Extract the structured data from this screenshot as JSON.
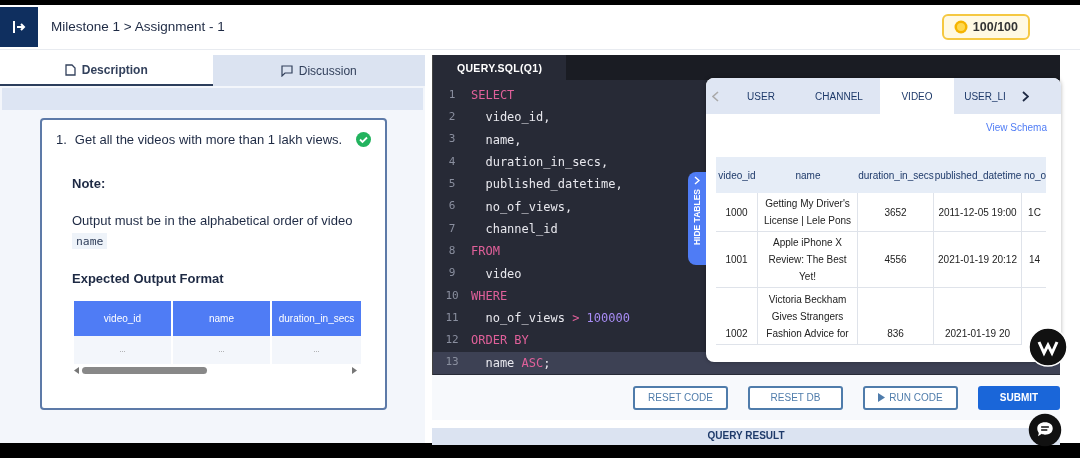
{
  "header": {
    "breadcrumb": "Milestone 1 > Assignment - 1",
    "score": "100/100"
  },
  "left_tabs": [
    {
      "label": "Description",
      "selected": true
    },
    {
      "label": "Discussion",
      "selected": false
    }
  ],
  "question": {
    "number": "1.",
    "text": "Get all the videos with more than 1 lakh views.",
    "solved": true,
    "note_label": "Note:",
    "note_text": "Output must be in the alphabetical order of video",
    "note_code": "name",
    "format_title": "Expected Output Format",
    "columns": [
      "video_id",
      "name",
      "duration_in_secs"
    ],
    "row": [
      "...",
      "...",
      "..."
    ]
  },
  "editor": {
    "tab": "QUERY.SQL(Q1)",
    "lines": [
      [
        {
          "t": "SELECT",
          "kind": "keyword"
        }
      ],
      [
        {
          "t": "  video_id,",
          "kind": "plain"
        }
      ],
      [
        {
          "t": "  name,",
          "kind": "plain"
        }
      ],
      [
        {
          "t": "  duration_in_secs,",
          "kind": "plain"
        }
      ],
      [
        {
          "t": "  published_datetime,",
          "kind": "plain"
        }
      ],
      [
        {
          "t": "  no_of_views,",
          "kind": "plain"
        }
      ],
      [
        {
          "t": "  channel_id",
          "kind": "plain"
        }
      ],
      [
        {
          "t": "FROM",
          "kind": "keyword"
        }
      ],
      [
        {
          "t": "  video",
          "kind": "plain"
        }
      ],
      [
        {
          "t": "WHERE",
          "kind": "keyword"
        }
      ],
      [
        {
          "t": "  no_of_views ",
          "kind": "plain"
        },
        {
          "t": ">",
          "kind": "operator"
        },
        {
          "t": " 100000",
          "kind": "number"
        }
      ],
      [
        {
          "t": "ORDER BY",
          "kind": "keyword"
        }
      ],
      [
        {
          "t": "  name ",
          "kind": "plain"
        },
        {
          "t": "ASC",
          "kind": "keyword"
        },
        {
          "t": ";",
          "kind": "plain"
        }
      ]
    ],
    "line_numbers": [
      "1",
      "2",
      "3",
      "4",
      "5",
      "6",
      "7",
      "8",
      "9",
      "10",
      "11",
      "12",
      "13"
    ]
  },
  "tables_panel": {
    "toggle": "HIDE TABLES",
    "tabs": [
      {
        "label": "USER",
        "selected": false
      },
      {
        "label": "CHANNEL",
        "selected": false
      },
      {
        "label": "VIDEO",
        "selected": true
      },
      {
        "label": "USER_LI",
        "selected": false
      }
    ],
    "view_schema": "View Schema",
    "columns": [
      "video_id",
      "name",
      "duration_in_secs",
      "published_datetime",
      "no_o"
    ],
    "rows": [
      [
        "1000",
        "Getting My Driver's License | Lele Pons",
        "3652",
        "2011-12-05 19:00",
        "1C"
      ],
      [
        "1001",
        "Apple iPhone X Review: The Best Yet!",
        "4556",
        "2021-01-19 20:12",
        "14"
      ],
      [
        "1002",
        "Victoria Beckham Gives Strangers Fashion Advice for",
        "836",
        "2021-01-19 20"
      ]
    ]
  },
  "buttons": [
    {
      "label": "RESET CODE",
      "kind": "outline"
    },
    {
      "label": "RESET DB",
      "kind": "outline"
    },
    {
      "label": "RUN CODE",
      "kind": "run"
    },
    {
      "label": "SUBMIT",
      "kind": "primary"
    }
  ],
  "result_bar": "QUERY RESULT"
}
